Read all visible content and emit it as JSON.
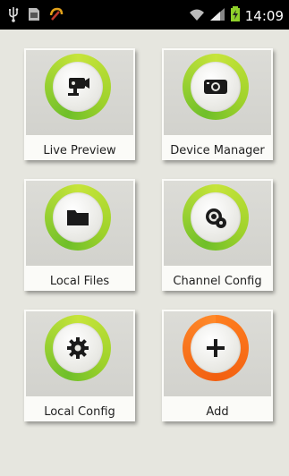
{
  "status_bar": {
    "time": "14:09",
    "icons": [
      "usb-icon",
      "sd-card-icon",
      "notification-icon",
      "wifi-icon",
      "signal-icon",
      "battery-icon"
    ]
  },
  "menu": {
    "items": [
      {
        "label": "Live Preview",
        "icon": "camera-icon",
        "ring_color": "#9fd22b"
      },
      {
        "label": "Device Manager",
        "icon": "device-icon",
        "ring_color": "#9fd22b"
      },
      {
        "label": "Local Files",
        "icon": "folder-icon",
        "ring_color": "#9fd22b"
      },
      {
        "label": "Channel Config",
        "icon": "channel-config-icon",
        "ring_color": "#9fd22b"
      },
      {
        "label": "Local Config",
        "icon": "gear-icon",
        "ring_color": "#9fd22b"
      },
      {
        "label": "Add",
        "icon": "plus-icon",
        "ring_color": "#f25f10"
      }
    ]
  }
}
